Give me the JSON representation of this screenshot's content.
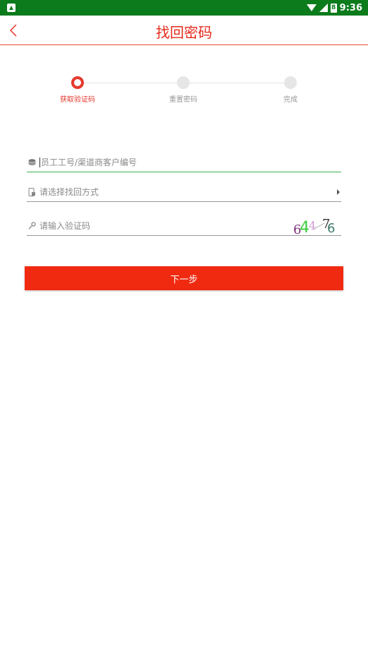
{
  "status_bar": {
    "time": "9:36",
    "battery_digit": "8"
  },
  "header": {
    "title": "找回密码"
  },
  "steps": [
    {
      "label": "获取验证码",
      "state": "active"
    },
    {
      "label": "重置密码",
      "state": "pending"
    },
    {
      "label": "完成",
      "state": "pending"
    }
  ],
  "form": {
    "employee_id": {
      "placeholder": "员工工号/渠道商客户编号",
      "value": ""
    },
    "method": {
      "placeholder": "请选择找回方式",
      "value": ""
    },
    "code": {
      "placeholder": "请输入验证码",
      "value": ""
    },
    "captcha_chars": [
      "6",
      "4",
      "4",
      "7",
      "6"
    ]
  },
  "actions": {
    "next_label": "下一步"
  },
  "colors": {
    "status_bar": "#0b7b1c",
    "accent": "#e42a1c",
    "button": "#ef2a10",
    "focus_line": "#3fae52"
  }
}
